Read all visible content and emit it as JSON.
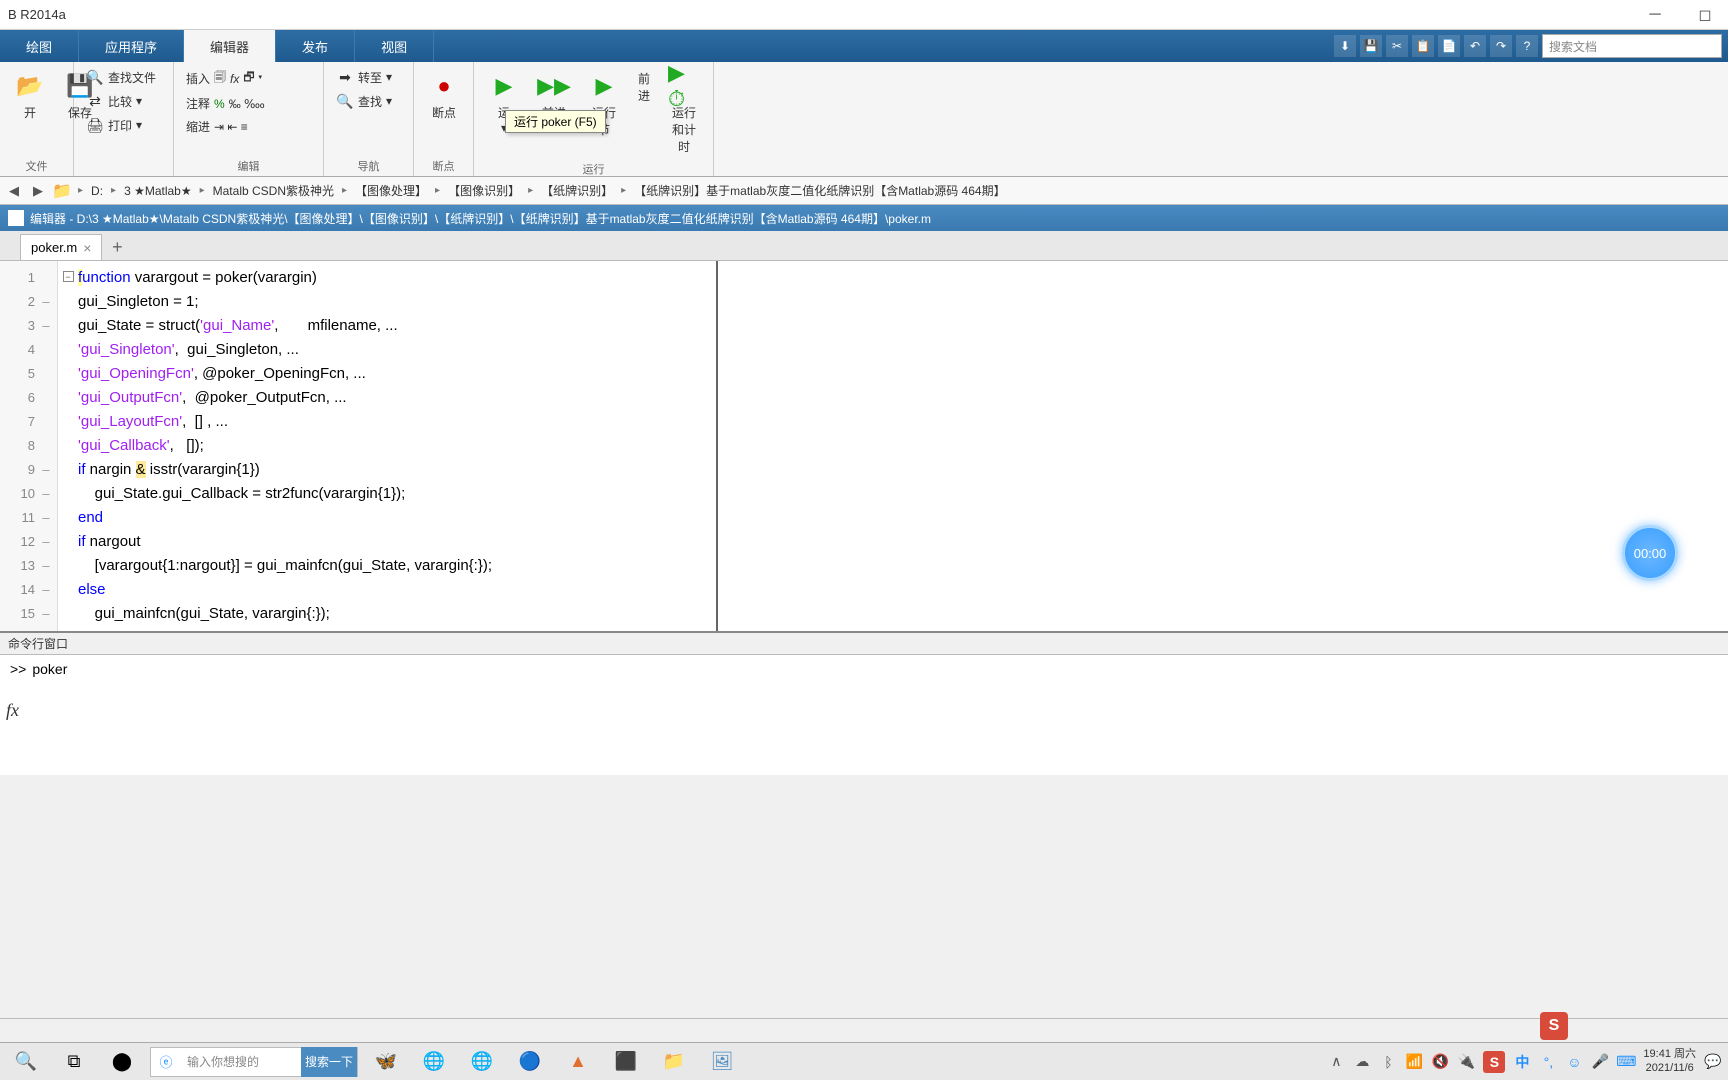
{
  "window": {
    "title": "B R2014a"
  },
  "ribbon": {
    "tabs": [
      "绘图",
      "应用程序",
      "编辑器",
      "发布",
      "视图"
    ],
    "active_index": 2,
    "search_placeholder": "搜索文档",
    "groups": {
      "file": {
        "label": "文件",
        "open": "开",
        "save": "保存",
        "find_files": "查找文件",
        "compare": "比较",
        "print": "打印"
      },
      "edit": {
        "label": "编辑",
        "insert": "插入",
        "fx": "fx",
        "comment": "注释",
        "indent": "缩进"
      },
      "nav": {
        "label": "导航",
        "goto": "转至",
        "find": "查找"
      },
      "bp": {
        "label": "断点",
        "breakpoint": "断点"
      },
      "run": {
        "label": "运行",
        "run": "运",
        "advance": "前进",
        "run_section": "运行节",
        "run_advance": "前进",
        "run_time": "运行和计时"
      }
    },
    "tooltip": "运行 poker (F5)"
  },
  "path": {
    "segments": [
      "D:",
      "3 ★Matlab★",
      "Matalb CSDN紫极神光",
      "【图像处理】",
      "【图像识别】",
      "【纸牌识别】",
      "【纸牌识别】基于matlab灰度二值化纸牌识别【含Matlab源码 464期】"
    ]
  },
  "editor": {
    "title": "编辑器 - D:\\3 ★Matlab★\\Matalb CSDN紫极神光\\【图像处理】\\【图像识别】\\【纸牌识别】\\【纸牌识别】基于matlab灰度二值化纸牌识别【含Matlab源码 464期】\\poker.m",
    "tab_name": "poker.m",
    "lines": [
      {
        "n": 1,
        "dash": "",
        "fold": "−",
        "html": "<span class='kw cursor-hl'>f</span><span class='kw'>unction</span> varargout = poker(varargin)"
      },
      {
        "n": 2,
        "dash": "–",
        "fold": "",
        "html": "gui_Singleton = 1;"
      },
      {
        "n": 3,
        "dash": "–",
        "fold": "",
        "html": "gui_State = struct(<span class='str'>'gui_Name'</span>,       mfilename, ..."
      },
      {
        "n": 4,
        "dash": "",
        "fold": "",
        "html": "                   <span class='str'>'gui_Singleton'</span>,  gui_Singleton, ..."
      },
      {
        "n": 5,
        "dash": "",
        "fold": "",
        "html": "                   <span class='str'>'gui_OpeningFcn'</span>, @poker_OpeningFcn, ..."
      },
      {
        "n": 6,
        "dash": "",
        "fold": "",
        "html": "                   <span class='str'>'gui_OutputFcn'</span>,  @poker_OutputFcn, ..."
      },
      {
        "n": 7,
        "dash": "",
        "fold": "",
        "html": "                   <span class='str'>'gui_LayoutFcn'</span>,  [] , ..."
      },
      {
        "n": 8,
        "dash": "",
        "fold": "",
        "html": "                   <span class='str'>'gui_Callback'</span>,   []);"
      },
      {
        "n": 9,
        "dash": "–",
        "fold": "",
        "html": "<span class='kw'>if</span> nargin <span class='op-hl'>&</span> isstr(varargin{1})"
      },
      {
        "n": 10,
        "dash": "–",
        "fold": "",
        "html": "    gui_State.gui_Callback = str2func(varargin{1});"
      },
      {
        "n": 11,
        "dash": "–",
        "fold": "",
        "html": "<span class='kw'>end</span>"
      },
      {
        "n": 12,
        "dash": "–",
        "fold": "",
        "html": "<span class='kw'>if</span> nargout"
      },
      {
        "n": 13,
        "dash": "–",
        "fold": "",
        "html": "    [varargout{1:nargout}] = gui_mainfcn(gui_State, varargin{:});"
      },
      {
        "n": 14,
        "dash": "–",
        "fold": "",
        "html": "<span class='kw'>else</span>"
      },
      {
        "n": 15,
        "dash": "–",
        "fold": "",
        "html": "    gui_mainfcn(gui_State, varargin{:});"
      }
    ]
  },
  "cmd": {
    "title": "命令行窗口",
    "prompt": ">>",
    "text": "poker",
    "fx": "fx"
  },
  "timer": {
    "value": "00:00"
  },
  "taskbar": {
    "search_placeholder": "输入你想搜的",
    "search_btn": "搜索一下",
    "ime_zh": "中",
    "time": "19:41",
    "day": "周六",
    "date": "2021/11/6"
  }
}
